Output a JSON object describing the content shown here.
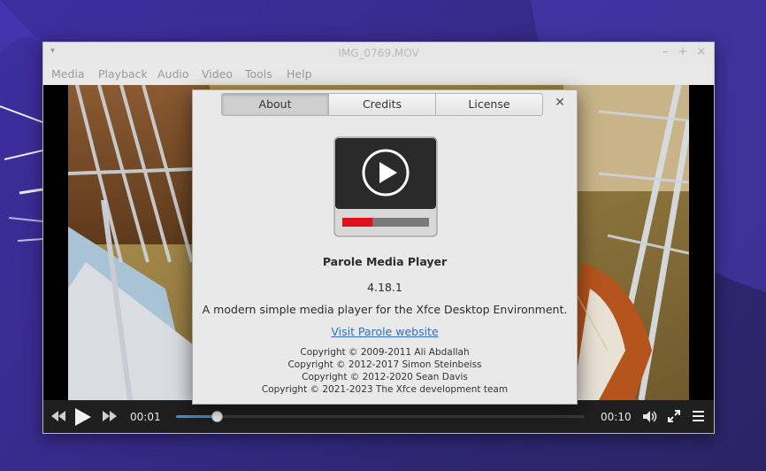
{
  "window": {
    "title": "IMG_0769.MOV",
    "controls": [
      "minimize-icon",
      "maximize-icon",
      "close-icon"
    ]
  },
  "menubar": {
    "items": [
      {
        "label": "Media"
      },
      {
        "label": "Playback"
      },
      {
        "label": "Audio"
      },
      {
        "label": "Video"
      },
      {
        "label": "Tools"
      },
      {
        "label": "Help"
      }
    ]
  },
  "player": {
    "elapsed": "00:01",
    "duration": "00:10",
    "progress_fraction": 0.1,
    "icons": [
      "rewind-icon",
      "play-icon",
      "fast-forward-icon",
      "volume-icon",
      "fullscreen-icon",
      "playlist-menu-icon"
    ],
    "accent_color": "#3f8fd6"
  },
  "about": {
    "tabs": [
      {
        "label": "About",
        "active": true
      },
      {
        "label": "Credits",
        "active": false
      },
      {
        "label": "License",
        "active": false
      }
    ],
    "app_name": "Parole Media Player",
    "version": "4.18.1",
    "description": "A modern simple media player for the Xfce Desktop Environment.",
    "website_link": "Visit Parole website",
    "copyright": [
      "Copyright © 2009-2011 Ali Abdallah",
      "Copyright © 2012-2017 Simon Steinbeiss",
      "Copyright © 2012-2020 Sean Davis",
      "Copyright © 2021-2023 The Xfce development team"
    ],
    "icon_progress_fraction": 0.35,
    "icon_progress_color": "#e0101a",
    "link_color": "#2f6fc4"
  }
}
